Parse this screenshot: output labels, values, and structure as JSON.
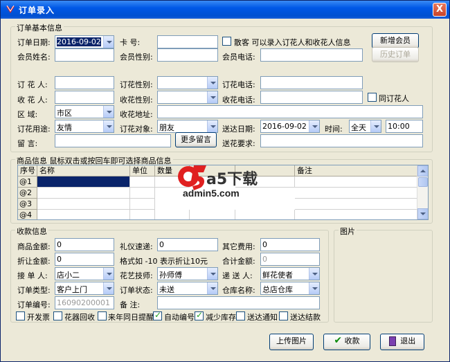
{
  "window": {
    "title": "订单录入",
    "close": "X"
  },
  "basic": {
    "group_title": "订单基本信息",
    "order_date_label": "订单日期:",
    "order_date_value": "2016-09-02",
    "card_label": "卡    号:",
    "card_value": "",
    "walkin_label": "散客 可以录入订花人和收花人信息",
    "add_member_btn": "新增会员",
    "history_btn": "历史订单",
    "member_name_label": "会员姓名:",
    "member_gender_label": "会员性别:",
    "member_phone_label": "会员电话:",
    "orderer_label": "订 花 人:",
    "orderer_gender_label": "订花性别:",
    "orderer_phone_label": "订花电话:",
    "receiver_label": "收 花 人:",
    "receiver_gender_label": "收花性别:",
    "receiver_phone_label": "收花电话:",
    "same_as_orderer_label": "同订花人",
    "area_label": "区    域:",
    "area_value": "市区",
    "address_label": "收花地址:",
    "purpose_label": "订花用途:",
    "purpose_value": "友情",
    "target_label": "订花对象:",
    "target_value": "朋友",
    "delivery_date_label": "送达日期:",
    "delivery_date_value": "2016-09-02",
    "time_label": "时间:",
    "time_period_value": "全天",
    "time_value": "10:00",
    "message_label": "留    言:",
    "more_message_btn": "更多留言",
    "delivery_req_label": "送花要求:"
  },
  "goods": {
    "group_title": "商品信息 鼠标双击或按回车即可选择商品信息",
    "columns": [
      "序号",
      "名称",
      "单位",
      "数量",
      "",
      "",
      "备注"
    ],
    "rows": [
      "@1",
      "@2",
      "@3",
      "@4"
    ]
  },
  "watermark": {
    "brand": "a5下载",
    "url": "admin5.com"
  },
  "payment": {
    "group_title": "收款信息",
    "goods_amount_label": "商品金额:",
    "goods_amount_value": "0",
    "gift_label": "礼仪速递:",
    "gift_value": "0",
    "other_fee_label": "其它费用:",
    "other_fee_value": "0",
    "discount_label": "折让金额:",
    "discount_value": "0",
    "discount_hint": "格式如 -10 表示折让10元",
    "total_label": "合计金额:",
    "total_value": "0",
    "receiver_op_label": "接 单 人:",
    "receiver_op_value": "店小二",
    "florist_label": "花艺技师:",
    "florist_value": "孙师傅",
    "courier_label": "递 送 人:",
    "courier_value": "鲜花使者",
    "order_type_label": "订单类型:",
    "order_type_value": "客户上门",
    "order_status_label": "订单状态:",
    "order_status_value": "未送",
    "warehouse_label": "仓库名称:",
    "warehouse_value": "总店仓库",
    "order_no_label": "订单编号:",
    "order_no_value": "16090200001",
    "remark_label": "备    注:",
    "checkboxes": [
      {
        "label": "开发票",
        "checked": false
      },
      {
        "label": "花器回收",
        "checked": false
      },
      {
        "label": "来年同日提醒",
        "checked": false
      },
      {
        "label": "自动编号",
        "checked": true
      },
      {
        "label": "减少库存",
        "checked": true
      },
      {
        "label": "送达通知",
        "checked": false
      },
      {
        "label": "送达结款",
        "checked": false
      }
    ]
  },
  "picture": {
    "group_title": "图片"
  },
  "actions": {
    "upload": "上传图片",
    "collect": "收款",
    "exit": "退出"
  },
  "colors": {
    "titlebar": "#0058e6",
    "selection": "#0a246a",
    "window_bg": "#ece9d8"
  }
}
